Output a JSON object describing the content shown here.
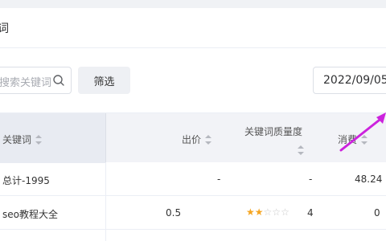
{
  "header": {
    "title": "词"
  },
  "search": {
    "placeholder": "搜索关键词"
  },
  "filter": {
    "label": "筛选"
  },
  "date": {
    "value": "2022/09/05"
  },
  "table": {
    "columns": {
      "keyword": "关键词",
      "bid": "出价",
      "quality": "关键词质量度",
      "spend": "消费"
    },
    "rows": [
      {
        "keyword": "总计-1995",
        "bid": "-",
        "quality": "-",
        "spend": "48.24",
        "stars": null
      },
      {
        "keyword": "seo教程大全",
        "bid": "0.5",
        "quality": "4",
        "spend": "0",
        "stars": 2
      }
    ]
  },
  "colors": {
    "accent_arrow": "#cc22dd",
    "star": "#f5a623"
  }
}
